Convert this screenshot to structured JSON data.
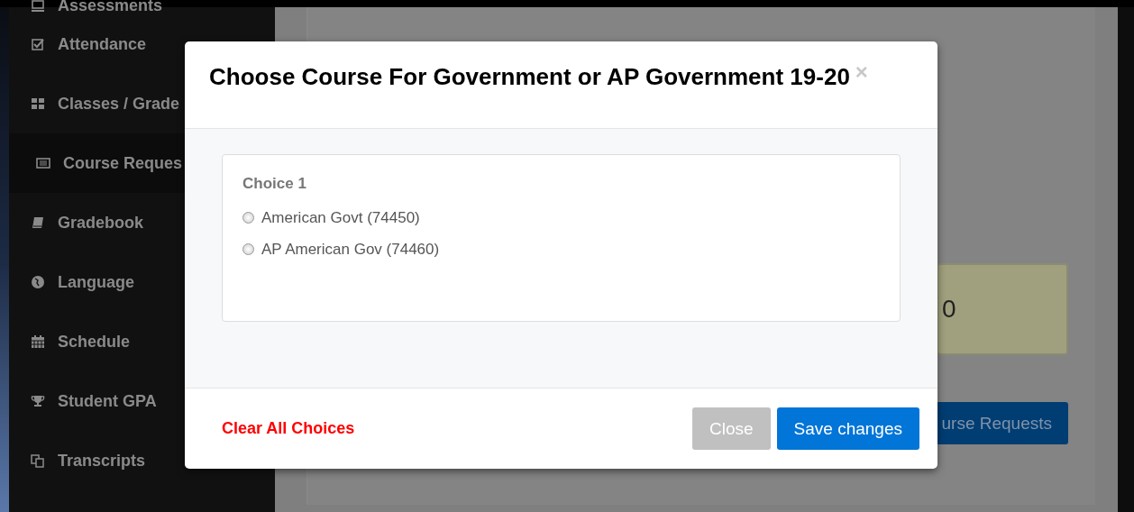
{
  "sidebar": {
    "items": [
      {
        "label": "Assessments",
        "selected": false
      },
      {
        "label": "Attendance",
        "selected": false
      },
      {
        "label": "Classes / Grade",
        "selected": false
      },
      {
        "label": "Course Reques",
        "selected": true
      },
      {
        "label": "Gradebook",
        "selected": false
      },
      {
        "label": "Language",
        "selected": false
      },
      {
        "label": "Schedule",
        "selected": false
      },
      {
        "label": "Student GPA",
        "selected": false
      },
      {
        "label": "Transcripts",
        "selected": false
      }
    ]
  },
  "background": {
    "total_value": "0",
    "button": "urse Requests"
  },
  "modal": {
    "title": "Choose Course For Government or AP Government 19-20",
    "close_glyph": "×",
    "choice_group": {
      "heading": "Choice 1",
      "options": [
        {
          "label": "American Govt (74450)",
          "selected": false
        },
        {
          "label": "AP American Gov (74460)",
          "selected": false
        }
      ]
    },
    "clear_link": "Clear All Choices",
    "buttons": [
      {
        "label": "Close",
        "kind": "secondary",
        "disabled": true
      },
      {
        "label": "Save changes",
        "kind": "primary",
        "disabled": false
      }
    ]
  }
}
